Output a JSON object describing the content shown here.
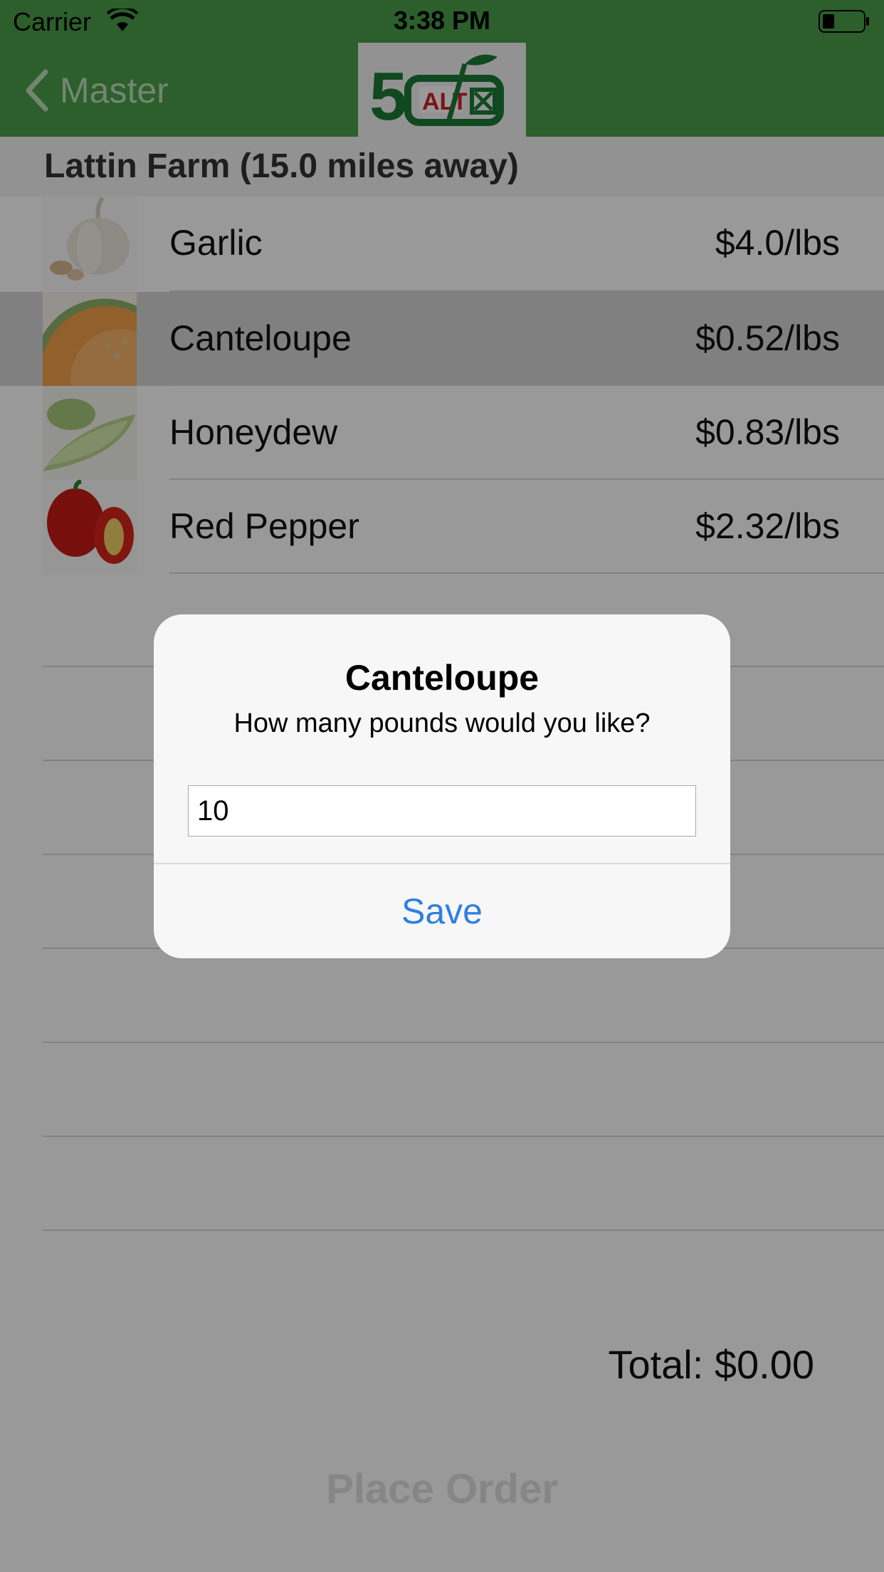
{
  "status_bar": {
    "carrier": "Carrier",
    "time": "3:38 PM"
  },
  "nav": {
    "back_label": "Master",
    "logo_text": "ALT"
  },
  "farm": {
    "header": "Lattin Farm (15.0 miles away)"
  },
  "products": [
    {
      "name": "Garlic",
      "price": "$4.0/lbs",
      "image": "garlic-image"
    },
    {
      "name": "Canteloupe",
      "price": "$0.52/lbs",
      "image": "cantaloupe-image"
    },
    {
      "name": "Honeydew",
      "price": "$0.83/lbs",
      "image": "honeydew-image"
    },
    {
      "name": "Red Pepper",
      "price": "$2.32/lbs",
      "image": "red-pepper-image"
    }
  ],
  "total_label": "Total: $0.00",
  "place_order_label": "Place Order",
  "alert": {
    "title": "Canteloupe",
    "message": "How many pounds would you like?",
    "input_value": "10",
    "save_label": "Save"
  },
  "colors": {
    "nav_green": "#4a9e48",
    "action_blue": "#2f7fe0"
  }
}
